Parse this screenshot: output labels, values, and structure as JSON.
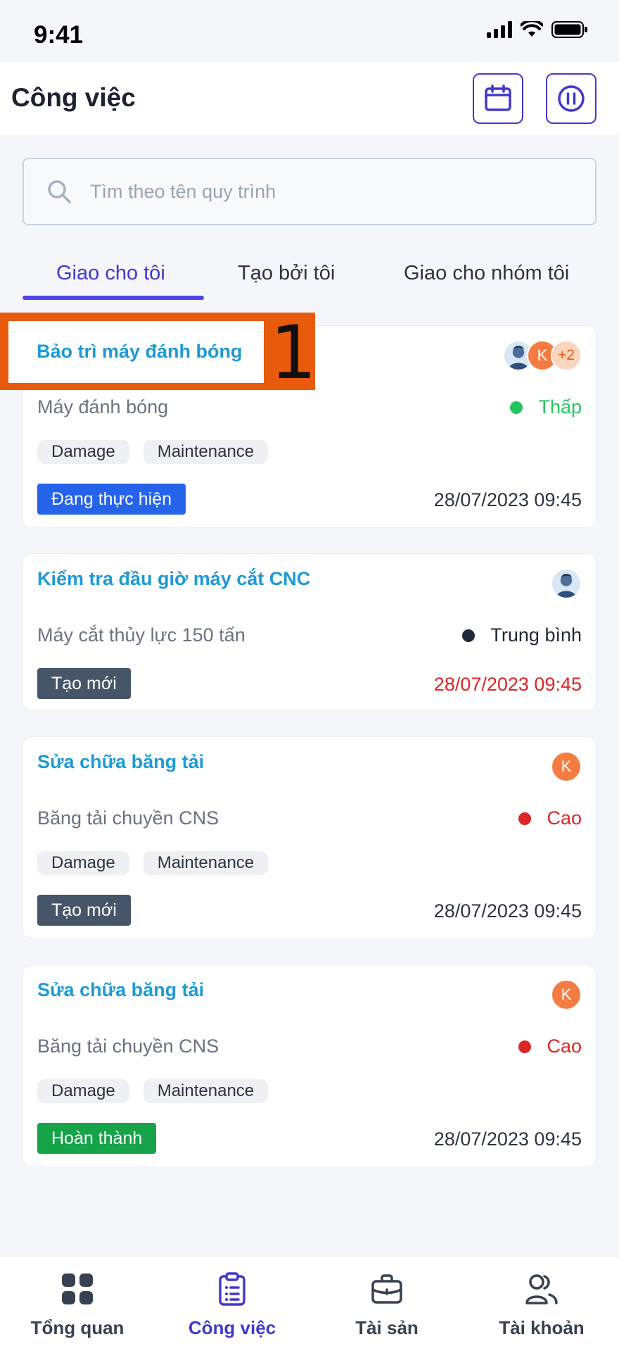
{
  "status_bar": {
    "time": "9:41"
  },
  "header": {
    "title": "Công việc",
    "calendar_icon": "calendar-icon",
    "pause_icon": "pause-circle-icon"
  },
  "search": {
    "placeholder": "Tìm theo tên quy trình",
    "value": ""
  },
  "tabs": [
    {
      "label": "Giao cho tôi",
      "active": true
    },
    {
      "label": "Tạo bởi tôi",
      "active": false
    },
    {
      "label": "Giao cho nhóm tôi",
      "active": false
    }
  ],
  "annotation": {
    "number": "1"
  },
  "tasks": [
    {
      "title": "Bảo trì máy đánh bóng",
      "asset": "Máy đánh bóng",
      "priority": "Thấp",
      "priority_color": "#22c55e",
      "tags": [
        "Damage",
        "Maintenance"
      ],
      "status": "Đang thực hiện",
      "status_color": "#2563eb",
      "date": "28/07/2023 09:45",
      "date_overdue": false,
      "avatars": {
        "initial": "K",
        "more": "+2"
      }
    },
    {
      "title": "Kiểm tra đầu giờ máy cắt CNC",
      "asset": "Máy cắt thủy lực 150 tấn",
      "priority": "Trung bình",
      "priority_color": "#1e293b",
      "tags": [],
      "status": "Tạo mới",
      "status_color": "#475569",
      "date": "28/07/2023 09:45",
      "date_overdue": true
    },
    {
      "title": "Sửa chữa băng tải",
      "asset": "Băng tải chuyền CNS",
      "priority": "Cao",
      "priority_color": "#dc2626",
      "tags": [
        "Damage",
        "Maintenance"
      ],
      "status": "Tạo mới",
      "status_color": "#475569",
      "date": "28/07/2023 09:45",
      "date_overdue": false,
      "avatars": {
        "initial": "K"
      }
    },
    {
      "title": "Sửa chữa băng tải",
      "asset": "Băng tải chuyền CNS",
      "priority": "Cao",
      "priority_color": "#dc2626",
      "tags": [
        "Damage",
        "Maintenance"
      ],
      "status": "Hoàn thành",
      "status_color": "#16a34a",
      "date": "28/07/2023 09:45",
      "date_overdue": false,
      "avatars": {
        "initial": "K"
      }
    }
  ],
  "bottom_nav": [
    {
      "label": "Tổng quan",
      "icon": "grid-icon",
      "active": false
    },
    {
      "label": "Công việc",
      "icon": "clipboard-icon",
      "active": true
    },
    {
      "label": "Tài sản",
      "icon": "briefcase-icon",
      "active": false
    },
    {
      "label": "Tài khoản",
      "icon": "users-icon",
      "active": false
    }
  ],
  "colors": {
    "accent": "#4338ca",
    "link": "#1e9ad6",
    "annotation": "#e85a0c"
  }
}
